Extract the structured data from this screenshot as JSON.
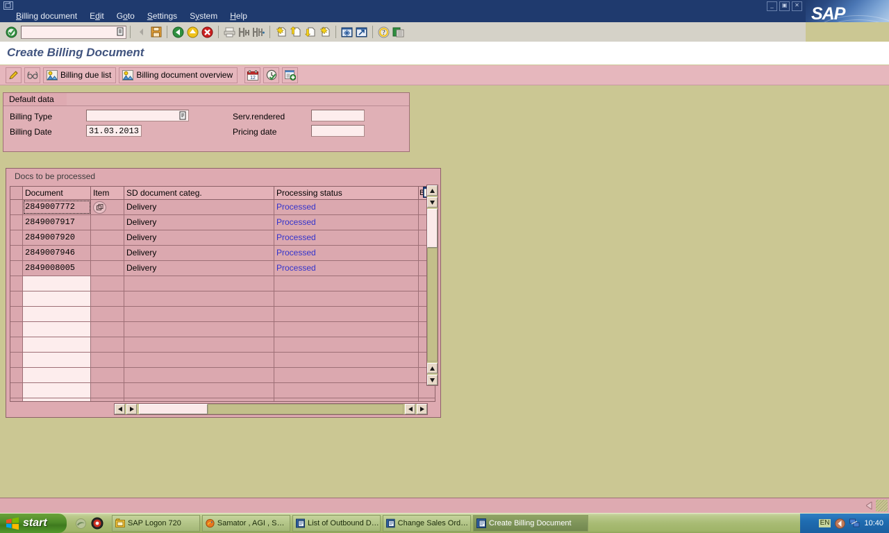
{
  "window": {
    "title": "Create Billing Document",
    "logo_text": "SAP",
    "sys_icon": "system-menu-icon",
    "win_buttons": [
      {
        "name": "minimize-button",
        "glyph": "_"
      },
      {
        "name": "restore-button",
        "glyph": "▣"
      },
      {
        "name": "close-button",
        "glyph": "✕"
      }
    ]
  },
  "menubar": {
    "items": [
      {
        "label": "Billing document",
        "accel_index": 0
      },
      {
        "label": "Edit",
        "accel_index": 1
      },
      {
        "label": "Goto",
        "accel_index": 1
      },
      {
        "label": "Settings",
        "accel_index": 0
      },
      {
        "label": "System",
        "accel_index": 1
      },
      {
        "label": "Help",
        "accel_index": 0
      }
    ]
  },
  "system_toolbar": {
    "enter_button": "enter-check-icon",
    "command_field": {
      "value": "",
      "placeholder": "",
      "dropdown_icon": "command-history-icon"
    },
    "buttons": [
      {
        "name": "back-nav-icon",
        "title": ""
      },
      {
        "name": "save-icon",
        "title": "Save"
      },
      {
        "name": "back-green-arrow-icon",
        "title": "Back"
      },
      {
        "name": "exit-yellow-up-icon",
        "title": "Exit"
      },
      {
        "name": "cancel-red-x-icon",
        "title": "Cancel"
      },
      {
        "name": "print-icon",
        "title": "Print"
      },
      {
        "name": "find-icon",
        "title": "Find"
      },
      {
        "name": "find-next-icon",
        "title": "Find Next"
      },
      {
        "name": "first-page-icon",
        "title": "First Page"
      },
      {
        "name": "previous-page-icon",
        "title": "Previous Page"
      },
      {
        "name": "next-page-icon",
        "title": "Next Page"
      },
      {
        "name": "last-page-icon",
        "title": "Last Page"
      },
      {
        "name": "create-session-icon",
        "title": "Create New Session"
      },
      {
        "name": "create-shortcut-icon",
        "title": "Create Shortcut"
      },
      {
        "name": "help-icon",
        "title": "Help"
      },
      {
        "name": "customize-layout-icon",
        "title": "Customize Local Layout"
      }
    ]
  },
  "app_toolbar": {
    "buttons": [
      {
        "name": "edit-pencil-button",
        "label": "",
        "icon": "pencil-icon"
      },
      {
        "name": "display-glasses-button",
        "label": "",
        "icon": "glasses-icon"
      },
      {
        "name": "billing-due-list-button",
        "label": "Billing due list",
        "icon": "list-person-icon"
      },
      {
        "name": "billing-document-overview-button",
        "label": "Billing document overview",
        "icon": "list-person-icon"
      },
      {
        "name": "calendar-button",
        "label": "",
        "icon": "calendar-icon"
      },
      {
        "name": "clock-check-button",
        "label": "",
        "icon": "clock-check-icon"
      },
      {
        "name": "create-document-button",
        "label": "",
        "icon": "document-plus-icon"
      }
    ]
  },
  "default_data": {
    "group_title": "Default data",
    "fields": [
      {
        "name": "billing-type-field",
        "label": "Billing Type",
        "value": "",
        "has_dropdown": true
      },
      {
        "name": "billing-date-field",
        "label": "Billing Date",
        "value": "31.03.2013",
        "has_dropdown": false
      },
      {
        "name": "serv-rendered-field",
        "label": "Serv.rendered",
        "value": "",
        "has_dropdown": false
      },
      {
        "name": "pricing-date-field",
        "label": "Pricing date",
        "value": "",
        "has_dropdown": false
      }
    ]
  },
  "table": {
    "title": "Docs to be processed",
    "config_icon": "table-settings-icon",
    "columns": [
      {
        "key": "sel",
        "label": ""
      },
      {
        "key": "document",
        "label": "Document"
      },
      {
        "key": "item",
        "label": "Item"
      },
      {
        "key": "category",
        "label": "SD document categ."
      },
      {
        "key": "status",
        "label": "Processing status"
      },
      {
        "key": "billing",
        "label": "Billi"
      }
    ],
    "rows": [
      {
        "document": "2849007772",
        "item": "",
        "category": "Delivery",
        "status": "Processed",
        "billing": "",
        "focused": true,
        "has_item_button": true
      },
      {
        "document": "2849007917",
        "item": "",
        "category": "Delivery",
        "status": "Processed",
        "billing": "",
        "focused": false,
        "has_item_button": false
      },
      {
        "document": "2849007920",
        "item": "",
        "category": "Delivery",
        "status": "Processed",
        "billing": "",
        "focused": false,
        "has_item_button": false
      },
      {
        "document": "2849007946",
        "item": "",
        "category": "Delivery",
        "status": "Processed",
        "billing": "",
        "focused": false,
        "has_item_button": false
      },
      {
        "document": "2849008005",
        "item": "",
        "category": "Delivery",
        "status": "Processed",
        "billing": "",
        "focused": false,
        "has_item_button": false
      }
    ],
    "empty_row_count": 9
  },
  "scrollbars": {
    "vertical": {
      "up_icon": "scroll-up-arrow",
      "down_icon": "scroll-down-arrow"
    },
    "horizontal": {
      "left_icon": "scroll-left-arrow",
      "right_icon": "scroll-right-arrow"
    }
  },
  "status_bar": {
    "message": "",
    "collapse_icon": "status-collapse-arrow",
    "resize_grip": "resize-grip"
  },
  "taskbar": {
    "start_label": "start",
    "quick_launch": [
      {
        "name": "ie-icon"
      },
      {
        "name": "media-player-icon"
      }
    ],
    "tasks": [
      {
        "name": "task-sap-logon",
        "label": "SAP Logon 720",
        "icon": "sap-logon-icon",
        "active": false
      },
      {
        "name": "task-firefox",
        "label": "Samator , AGI , SGI -...",
        "icon": "firefox-icon",
        "active": false
      },
      {
        "name": "task-outbound-deliveries",
        "label": "List of Outbound Deli...",
        "icon": "sap-window-icon",
        "active": false
      },
      {
        "name": "task-change-sales-order",
        "label": "Change Sales Order: ...",
        "icon": "sap-window-icon",
        "active": false
      },
      {
        "name": "task-create-billing-document",
        "label": "Create Billing Document",
        "icon": "sap-window-icon",
        "active": true
      }
    ],
    "tray": {
      "language": "EN",
      "icons": [
        {
          "name": "volume-icon"
        },
        {
          "name": "network-icon"
        }
      ],
      "clock": "10:40"
    }
  },
  "colors": {
    "desktop": "#cbc793",
    "menubar": "#1f3a6e",
    "app_toolbar": "#e6b7bd",
    "group_box": "#e0b0b6",
    "grid": "#dba8af",
    "link": "#3333cc",
    "title_text": "#41547f"
  }
}
